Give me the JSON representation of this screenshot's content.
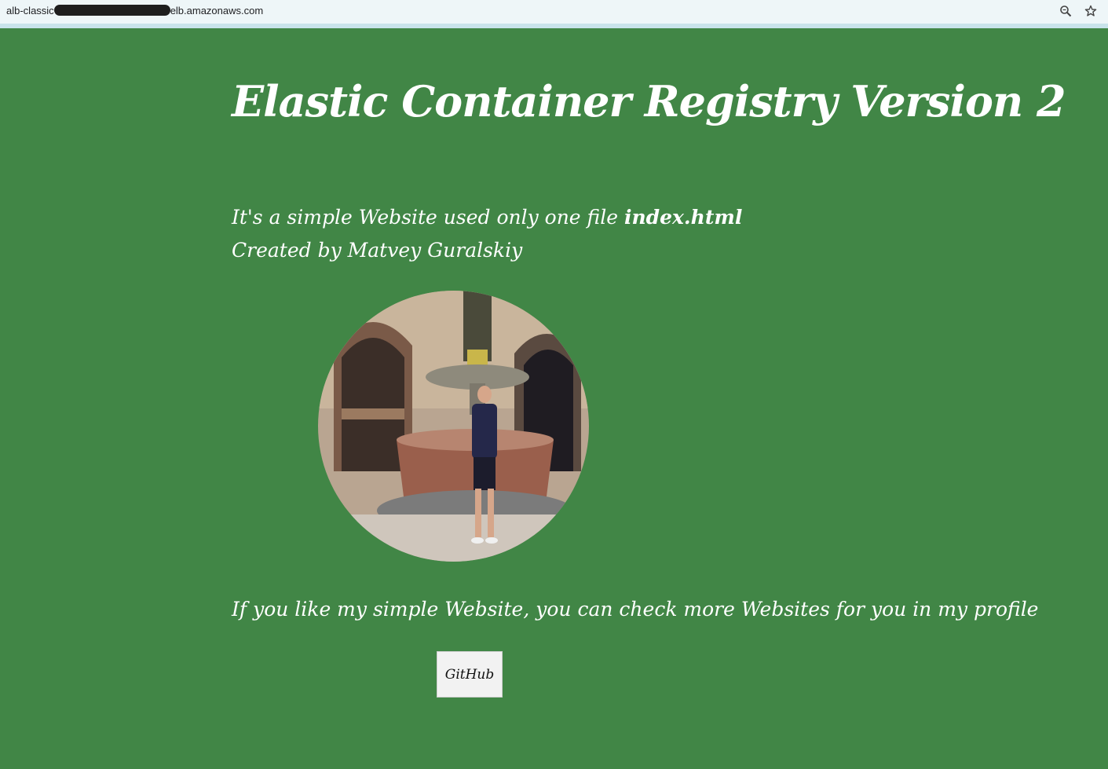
{
  "browser": {
    "url_prefix": "alb-classic",
    "url_suffix": "elb.amazonaws.com",
    "icons": [
      "zoom-icon",
      "bookmark-star-icon"
    ]
  },
  "page": {
    "title": "Elastic Container Registry Version 2",
    "intro_line1_text": "It's a simple Website used only one file ",
    "intro_line1_bold": "index.html",
    "intro_line2": "Created by Matvey Guralskiy",
    "profile_text": "If you like my simple Website, you can check more Websites for you in my profile",
    "github_button": "GitHub",
    "background_color": "#418646"
  }
}
